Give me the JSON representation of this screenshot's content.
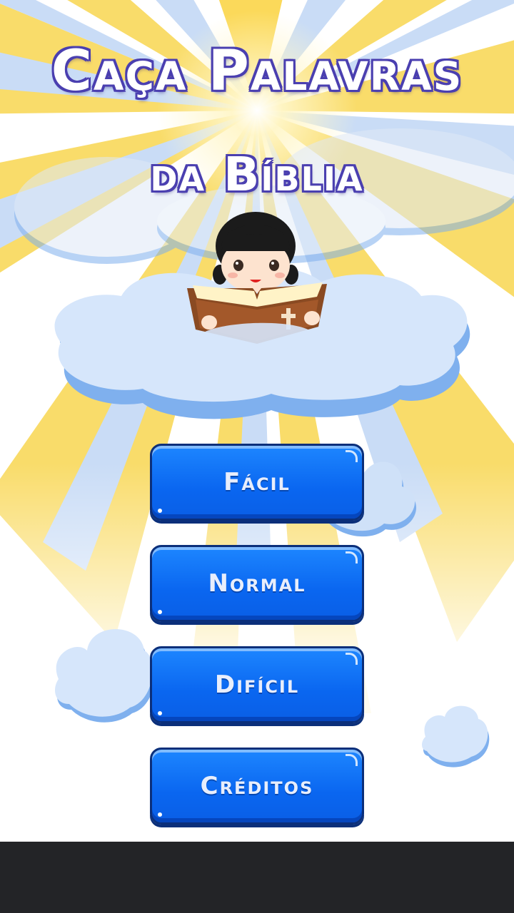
{
  "app": {
    "title_line1": "Caça Palavras",
    "title_line2": "da Bíblia"
  },
  "menu": {
    "items": [
      {
        "label": "Fácil"
      },
      {
        "label": "Normal"
      },
      {
        "label": "Difícil"
      },
      {
        "label": "Créditos"
      }
    ]
  },
  "illustration": {
    "icons": [
      "sun-rays-icon",
      "cloud-icon",
      "girl-reading-bible-icon",
      "cross-icon"
    ]
  },
  "colors": {
    "button_blue": "#0a66f0",
    "button_border": "#0b2f7a",
    "title_outline": "#4a3fb0",
    "ray_yellow": "#f9dc6a",
    "ray_blue": "#c9dcf6",
    "cloud": "#d6e6fb",
    "cloud_shadow": "#7fb0ee",
    "navbar": "#232427"
  }
}
